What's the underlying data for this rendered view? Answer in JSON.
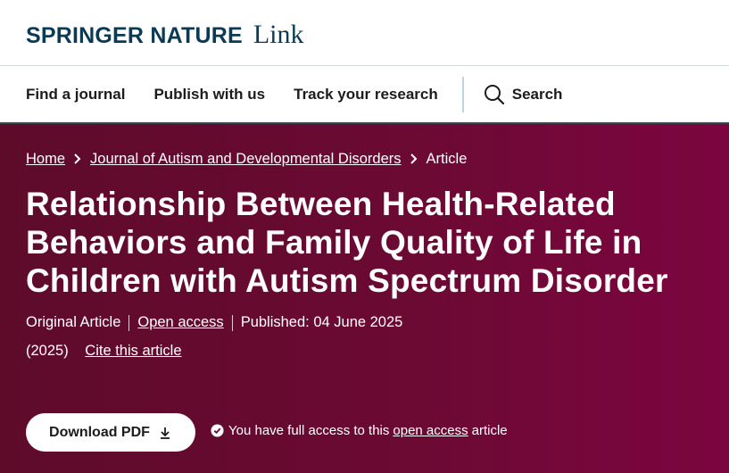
{
  "header": {
    "brand": "SPRINGER NATURE",
    "brand_suffix": "Link"
  },
  "nav": {
    "items": [
      {
        "label": "Find a journal"
      },
      {
        "label": "Publish with us"
      },
      {
        "label": "Track your research"
      }
    ],
    "search_label": "Search"
  },
  "breadcrumb": {
    "home": "Home",
    "journal": "Journal of Autism and Developmental Disorders",
    "current": "Article"
  },
  "article": {
    "title": "Relationship Between Health-Related Behaviors and Family Quality of Life in Children with Autism Spectrum Disorder",
    "type": "Original Article",
    "open_access": "Open access",
    "published": "Published: 04 June 2025",
    "year": "(2025)",
    "cite": "Cite this article"
  },
  "actions": {
    "download_pdf": "Download PDF",
    "access_prefix": "You have full access to this",
    "access_link": "open access",
    "access_suffix": "article"
  },
  "colors": {
    "brand_navy": "#0b3a55",
    "hero_bg": "#6b0a33",
    "button_bg": "#ffffff"
  },
  "icons": {
    "search": "search-icon",
    "download": "download-icon",
    "check": "check-circle-icon",
    "chevron": "chevron-right-icon"
  }
}
